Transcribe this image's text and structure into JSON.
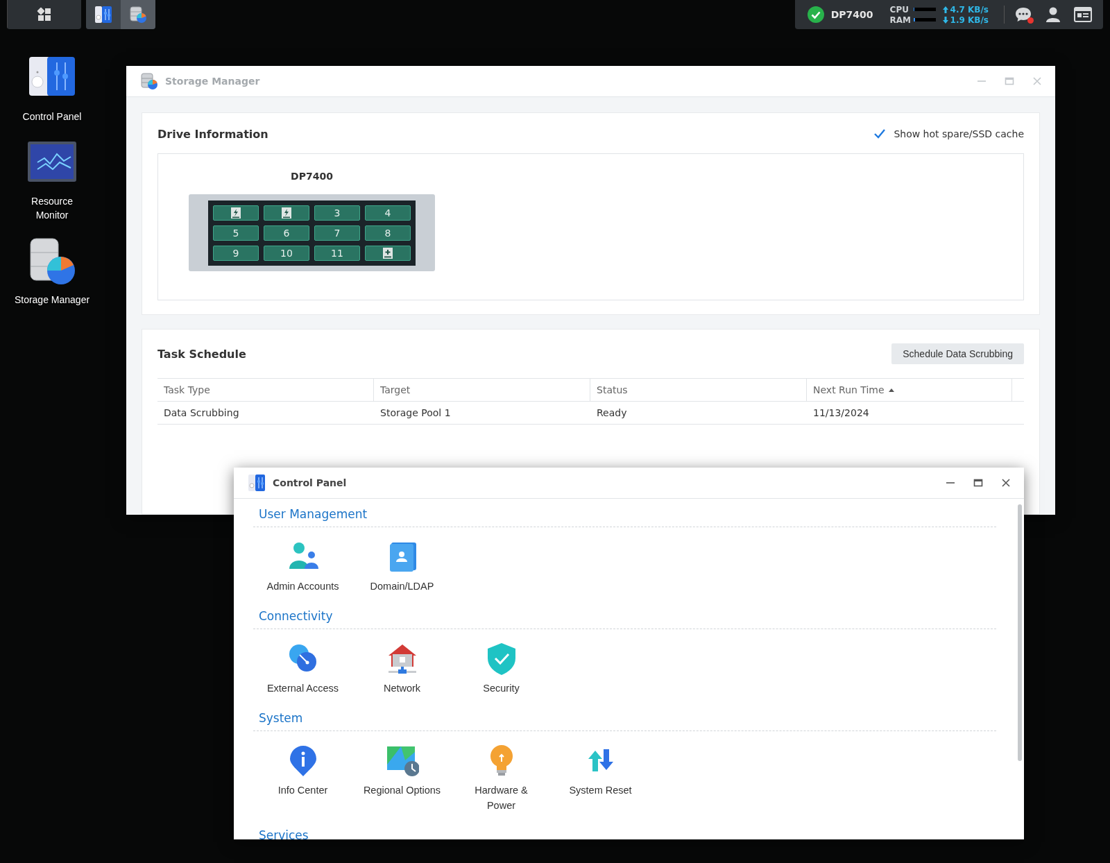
{
  "taskbar": {
    "apps": [
      {
        "kind": "main-menu"
      },
      {
        "kind": "control-panel",
        "selected": false
      },
      {
        "kind": "storage-manager",
        "selected": true
      }
    ]
  },
  "tray": {
    "status_ok": true,
    "device_name": "DP7400",
    "meters": [
      {
        "label": "CPU",
        "level": 0.02
      },
      {
        "label": "RAM",
        "level": 0.08
      }
    ],
    "rates": [
      {
        "kind": "upload",
        "text": "4.7 KB/s"
      },
      {
        "kind": "download",
        "text": "1.9 KB/s"
      }
    ],
    "notifications_unread": true
  },
  "desktop_icons": [
    {
      "kind": "control-panel",
      "label": "Control Panel"
    },
    {
      "kind": "resource-monitor",
      "label": "Resource\nMonitor"
    },
    {
      "kind": "storage-manager",
      "label": "Storage Manager"
    }
  ],
  "storage_manager": {
    "title": "Storage Manager",
    "focused": false,
    "drive_info": {
      "heading": "Drive Information",
      "show_cache": {
        "label": "Show hot spare/SSD cache",
        "checked": true
      },
      "device": {
        "name": "DP7400",
        "slots": [
          {
            "kind": "cache"
          },
          {
            "kind": "cache"
          },
          {
            "kind": "drive",
            "label": "3"
          },
          {
            "kind": "drive",
            "label": "4"
          },
          {
            "kind": "drive",
            "label": "5"
          },
          {
            "kind": "drive",
            "label": "6"
          },
          {
            "kind": "drive",
            "label": "7"
          },
          {
            "kind": "drive",
            "label": "8"
          },
          {
            "kind": "drive",
            "label": "9"
          },
          {
            "kind": "drive",
            "label": "10"
          },
          {
            "kind": "drive",
            "label": "11"
          },
          {
            "kind": "spare"
          }
        ]
      }
    },
    "task_schedule": {
      "heading": "Task Schedule",
      "button": "Schedule Data Scrubbing",
      "columns": [
        {
          "label": "Task Type"
        },
        {
          "label": "Target"
        },
        {
          "label": "Status"
        },
        {
          "label": "Next Run Time",
          "sorted_ascending": true
        }
      ],
      "rows": [
        [
          "Data Scrubbing",
          "Storage Pool 1",
          "Ready",
          "11/13/2024"
        ]
      ]
    }
  },
  "control_panel": {
    "title": "Control Panel",
    "focused": true,
    "sections": [
      {
        "heading": "User Management",
        "items": [
          {
            "kind": "admin-accounts",
            "label": "Admin Accounts"
          },
          {
            "kind": "domain-ldap",
            "label": "Domain/LDAP"
          }
        ]
      },
      {
        "heading": "Connectivity",
        "items": [
          {
            "kind": "external-access",
            "label": "External Access"
          },
          {
            "kind": "network",
            "label": "Network"
          },
          {
            "kind": "security",
            "label": "Security"
          }
        ]
      },
      {
        "heading": "System",
        "items": [
          {
            "kind": "info-center",
            "label": "Info Center"
          },
          {
            "kind": "regional-options",
            "label": "Regional Options"
          },
          {
            "kind": "hardware-power",
            "label": "Hardware & Power"
          },
          {
            "kind": "system-reset",
            "label": "System Reset"
          }
        ]
      },
      {
        "heading": "Services"
      }
    ]
  }
}
